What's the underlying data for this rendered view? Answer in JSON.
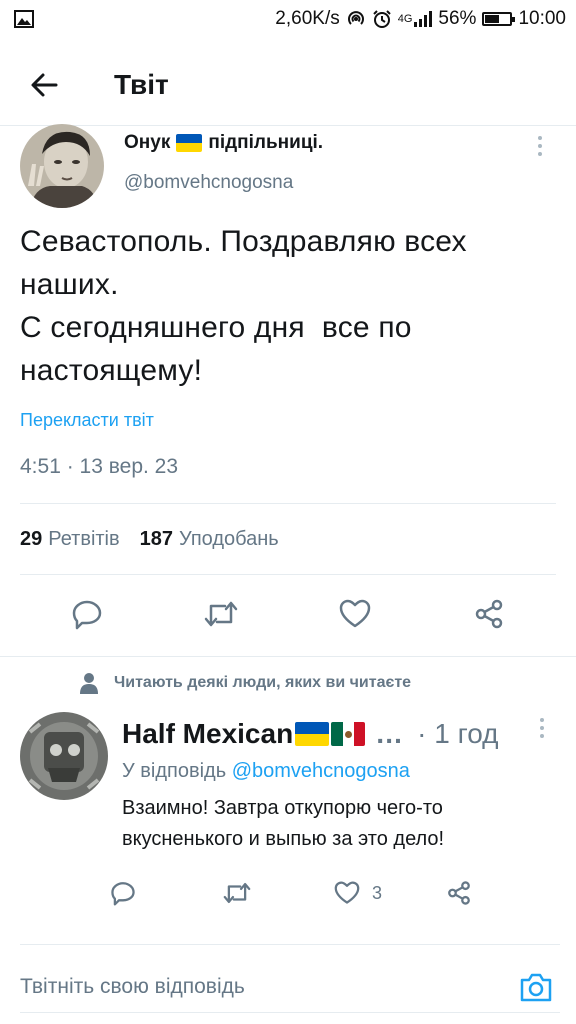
{
  "status_bar": {
    "network_speed": "2,60K/s",
    "network_type": "4G",
    "battery_percent": "56%",
    "battery_level": 0.56,
    "time": "10:00",
    "icons": [
      "image-icon",
      "hotspot-icon",
      "alarm-icon",
      "signal-icon",
      "battery-icon"
    ]
  },
  "header": {
    "title": "Твіт",
    "back_icon": "arrow-left-icon"
  },
  "tweet": {
    "author": {
      "name_part1": "Онук",
      "name_part2": "підпільниці.",
      "handle": "@bomvehcnogosna"
    },
    "text": "Севастополь. Поздравляю всех наших.\nС сегодняшнего дня  все по настоящему!",
    "translate_label": "Перекласти твіт",
    "timestamp": "4:51 · 13 вер. 23",
    "stats": {
      "retweets_count": "29",
      "retweets_label": "Ретвітів",
      "likes_count": "187",
      "likes_label": "Уподобань"
    },
    "actions": [
      "reply-icon",
      "retweet-icon",
      "like-icon",
      "share-icon"
    ]
  },
  "social_context": {
    "text": "Читають деякі люди, яких ви читаєте",
    "icon": "person-icon"
  },
  "reply": {
    "name": "Half Mexican",
    "ellipsis": "…",
    "time": "· 1 год",
    "replying_label": "У відповідь",
    "replying_to": "@bomvehcnogosna",
    "text": "Взаимно! Завтра откупорю чего-то\nвкусненького и выпью за это дело!",
    "likes_count": "3"
  },
  "compose": {
    "placeholder": "Твітніть свою відповідь",
    "icon": "camera-icon"
  },
  "colors": {
    "accent": "#1da1f2",
    "secondary_text": "#657786",
    "divider": "#e6ecf0",
    "flag_ua_blue": "#0057b7",
    "flag_ua_yellow": "#ffd700",
    "flag_mx_green": "#006847",
    "flag_mx_red": "#ce1126"
  }
}
